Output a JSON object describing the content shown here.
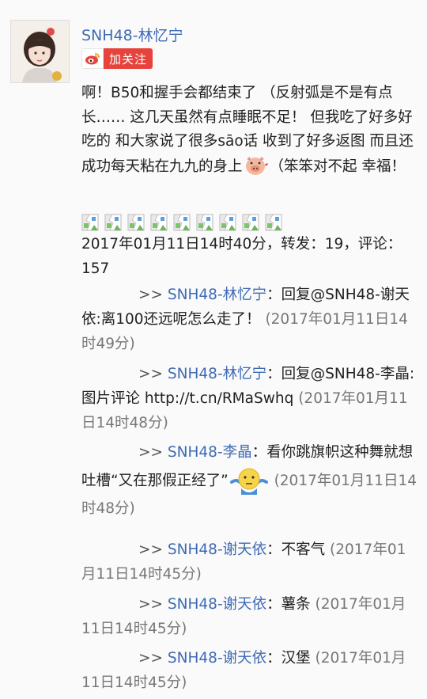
{
  "user": {
    "name": "SNH48-林忆宁",
    "follow_label": "加关注",
    "avatar_icon": "user-avatar-photo",
    "follow_icon": "weibo-icon"
  },
  "post": {
    "text_part1": "啊！B50和握手会都结束了 （反射弧是不是有点长…… 这几天虽然有点睡眠不足！ 但我吃了好多好吃的 和大家说了很多sāo话 收到了好多返图 而且还成功每天粘在九九的身上",
    "text_part2": "（笨笨对不起 幸福！",
    "emoji_1": "pig-emoji",
    "broken_images_count": 9,
    "meta": "2017年01月11日14时40分，转发：19，评论：157"
  },
  "replies": [
    {
      "arrow": ">>",
      "author": "SNH48-林忆宁",
      "text": "：回复@SNH48-谢天依:离100还远呢怎么走了！",
      "time": "(2017年01月11日14时49分)"
    },
    {
      "arrow": ">>",
      "author": "SNH48-林忆宁",
      "text": "：回复@SNH48-李晶:图片评论 http://t.cn/RMaSwhq",
      "time": "(2017年01月11日14时48分)"
    },
    {
      "arrow": ">>",
      "author": "SNH48-李晶",
      "text": "：看你跳旗帜这种舞就想吐槽“又在那假正经了”",
      "emoji": "shrug-emoji",
      "time": "(2017年01月11日14时48分)"
    },
    {
      "arrow": ">>",
      "author": "SNH48-谢天依",
      "text": "：不客气",
      "time": "(2017年01月11日14时45分)"
    },
    {
      "arrow": ">>",
      "author": "SNH48-谢天依",
      "text": "：薯条",
      "time": "(2017年01月11日14时45分)"
    },
    {
      "arrow": ">>",
      "author": "SNH48-谢天依",
      "text": "：汉堡",
      "time": "(2017年01月11日14时45分)"
    }
  ],
  "colors": {
    "name_blue": "#3f6bb5",
    "follow_red": "#e6433c",
    "time_gray": "#777777"
  }
}
